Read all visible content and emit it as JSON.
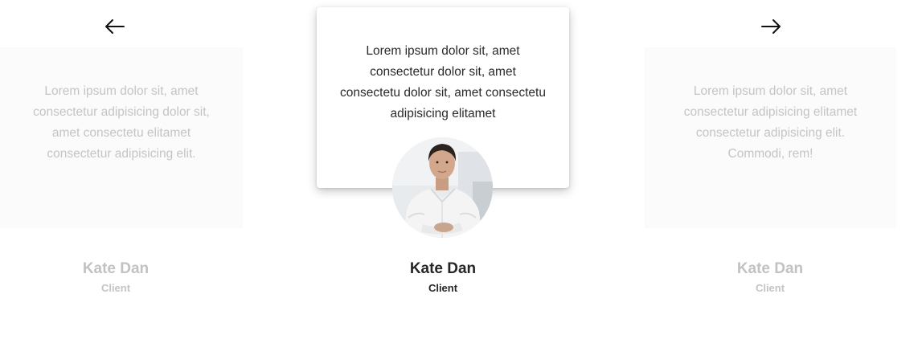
{
  "navigation": {
    "prev_icon": "arrow-left-icon",
    "next_icon": "arrow-right-icon"
  },
  "testimonials": [
    {
      "quote": "Lorem ipsum dolor sit, amet consectetur adipisicing dolor sit, amet consectetu elitamet consectetur adipisicing elit.",
      "name": "Kate Dan",
      "role": "Client"
    },
    {
      "quote": "Lorem ipsum dolor sit, amet consectetur dolor sit, amet consectetu dolor sit, amet consectetu adipisicing elitamet",
      "name": "Kate Dan",
      "role": "Client"
    },
    {
      "quote": "Lorem ipsum dolor sit, amet consectetur adipisicing elitamet consectetur adipisicing elit. Commodi, rem!",
      "name": "Kate Dan",
      "role": "Client"
    }
  ],
  "colors": {
    "active_text": "#2a2a2a",
    "faded_text": "#c4c4c4",
    "side_card_bg": "#fbfbfb"
  }
}
